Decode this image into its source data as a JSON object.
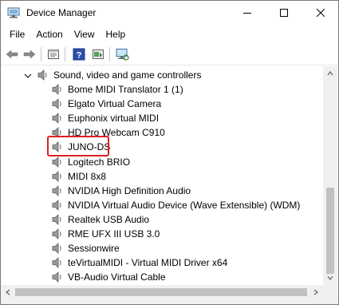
{
  "window": {
    "title": "Device Manager"
  },
  "menu": {
    "items": [
      "File",
      "Action",
      "View",
      "Help"
    ]
  },
  "toolbar": {
    "buttons": [
      "back-arrow",
      "forward-arrow",
      "properties",
      "help",
      "update-driver",
      "scan-hardware"
    ]
  },
  "tree": {
    "category": {
      "label": "Sound, video and game controllers",
      "expanded": true
    },
    "devices": [
      "Bome MIDI Translator 1 (1)",
      "Elgato Virtual Camera",
      "Euphonix virtual MIDI",
      "HD Pro Webcam C910",
      "JUNO-DS",
      "Logitech BRIO",
      "MIDI 8x8",
      "NVIDIA High Definition Audio",
      "NVIDIA Virtual Audio Device (Wave Extensible) (WDM)",
      "Realtek USB Audio",
      "RME UFX III USB 3.0",
      "Sessionwire",
      "teVirtualMIDI - Virtual MIDI Driver x64",
      "VB-Audio Virtual Cable"
    ],
    "highlighted_device": "JUNO-DS"
  },
  "colors": {
    "highlight_border": "#e02020",
    "title_icon": "#4a7fb5"
  }
}
